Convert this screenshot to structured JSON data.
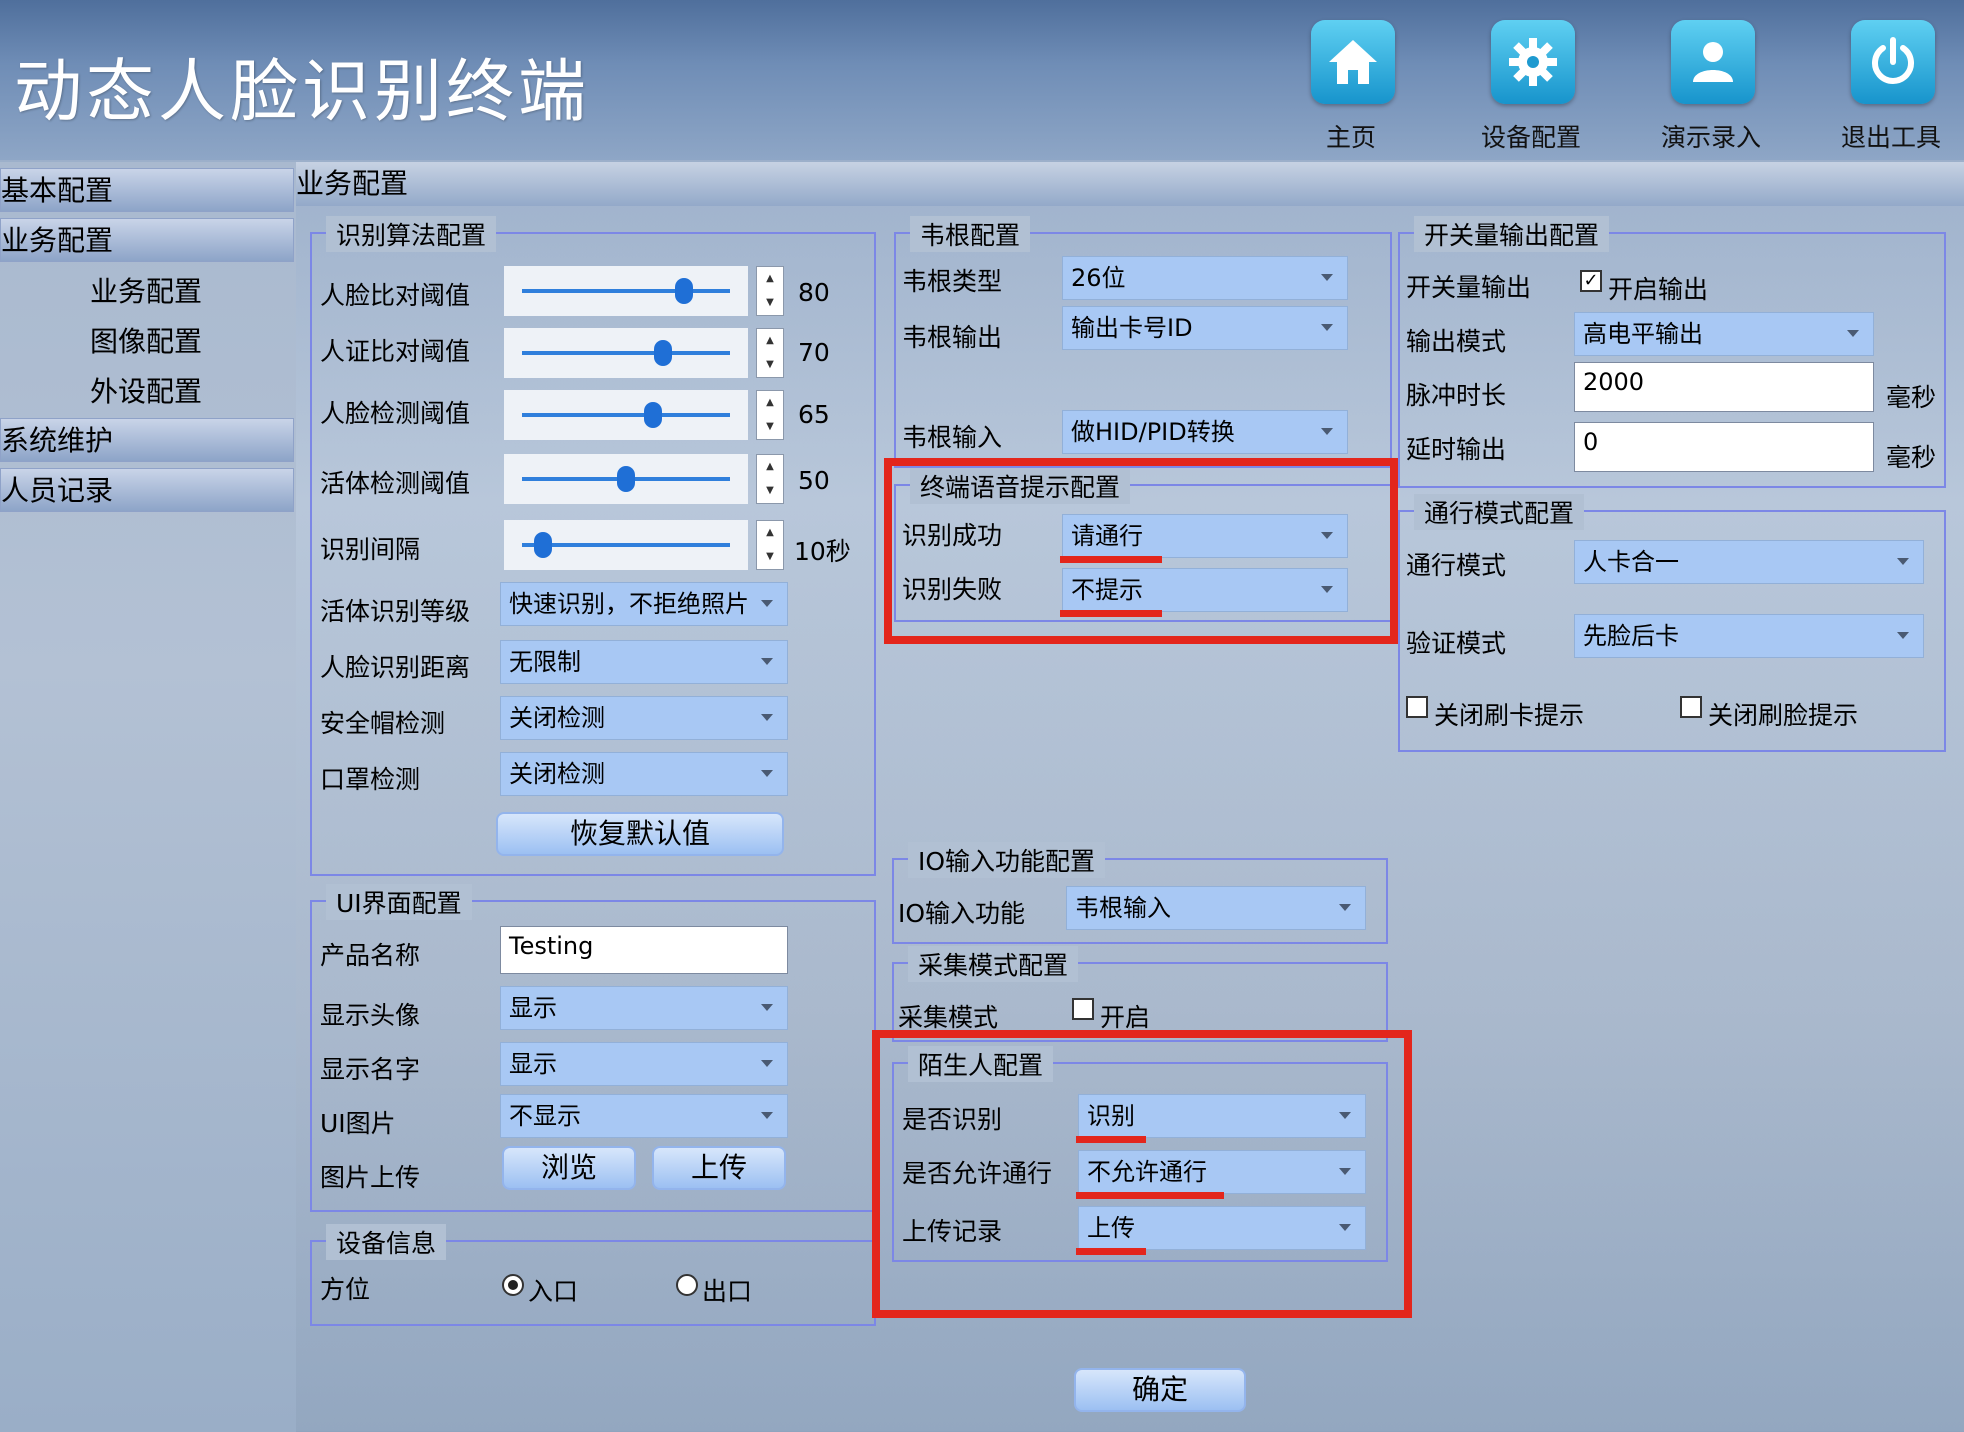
{
  "app_title": "动态人脸识别终端",
  "header_buttons": [
    {
      "label": "主页",
      "icon": "home-icon"
    },
    {
      "label": "设备配置",
      "icon": "gear-icon"
    },
    {
      "label": "演示录入",
      "icon": "users-icon"
    },
    {
      "label": "退出工具",
      "icon": "power-icon"
    }
  ],
  "sidebar": {
    "items": [
      "基本配置",
      "业务配置",
      "系统维护",
      "人员记录"
    ],
    "subitems": [
      "业务配置",
      "图像配置",
      "外设配置"
    ]
  },
  "content_title": "业务配置",
  "algo": {
    "legend": "识别算法配置",
    "sliders": [
      {
        "label": "人脸比对阈值",
        "value": "80",
        "fraction": 0.78
      },
      {
        "label": "人证比对阈值",
        "value": "70",
        "fraction": 0.68
      },
      {
        "label": "人脸检测阈值",
        "value": "65",
        "fraction": 0.63
      },
      {
        "label": "活体检测阈值",
        "value": "50",
        "fraction": 0.5
      },
      {
        "label": "识别间隔",
        "value": "10秒",
        "fraction": 0.1
      }
    ],
    "combos": [
      {
        "label": "活体识别等级",
        "value": "快速识别，不拒绝照片"
      },
      {
        "label": "人脸识别距离",
        "value": "无限制"
      },
      {
        "label": "安全帽检测",
        "value": "关闭检测"
      },
      {
        "label": "口罩检测",
        "value": "关闭检测"
      }
    ],
    "restore_button": "恢复默认值"
  },
  "ui": {
    "legend": "UI界面配置",
    "product_label": "产品名称",
    "product_value": "Testing",
    "combos": [
      {
        "label": "显示头像",
        "value": "显示"
      },
      {
        "label": "显示名字",
        "value": "显示"
      },
      {
        "label": "UI图片",
        "value": "不显示"
      }
    ],
    "upload_label": "图片上传",
    "browse_button": "浏览",
    "upload_button": "上传"
  },
  "device": {
    "legend": "设备信息",
    "direction_label": "方位",
    "options": [
      "入口",
      "出口"
    ],
    "selected": "入口"
  },
  "wiegand": {
    "legend": "韦根配置",
    "type_label": "韦根类型",
    "type_value": "26位",
    "output_label": "韦根输出",
    "output_value": "输出卡号ID",
    "input_label": "韦根输入",
    "input_value": "做HID/PID转换"
  },
  "voice": {
    "legend": "终端语音提示配置",
    "success_label": "识别成功",
    "success_value": "请通行",
    "fail_label": "识别失败",
    "fail_value": "不提示"
  },
  "io": {
    "legend": "IO输入功能配置",
    "label": "IO输入功能",
    "value": "韦根输入"
  },
  "collect": {
    "legend": "采集模式配置",
    "label": "采集模式",
    "check_label": "开启",
    "checked": false
  },
  "stranger": {
    "legend": "陌生人配置",
    "identify_label": "是否识别",
    "identify_value": "识别",
    "allow_label": "是否允许通行",
    "allow_value": "不允许通行",
    "upload_label": "上传记录",
    "upload_value": "上传"
  },
  "switch_out": {
    "legend": "开关量输出配置",
    "output_label": "开关量输出",
    "enable_label": "开启输出",
    "enabled": true,
    "mode_label": "输出模式",
    "mode_value": "高电平输出",
    "pulse_label": "脉冲时长",
    "pulse_value": "2000",
    "pulse_unit": "毫秒",
    "delay_label": "延时输出",
    "delay_value": "0",
    "delay_unit": "毫秒"
  },
  "pass": {
    "legend": "通行模式配置",
    "mode_label": "通行模式",
    "mode_value": "人卡合一",
    "verify_label": "验证模式",
    "verify_value": "先脸后卡",
    "close_card_tip": "关闭刷卡提示",
    "close_face_tip": "关闭刷脸提示"
  },
  "confirm_button": "确定",
  "colors": {
    "highlight": "#e3261c",
    "combo": "#a8c8f4",
    "accent": "#2f7fdc"
  }
}
